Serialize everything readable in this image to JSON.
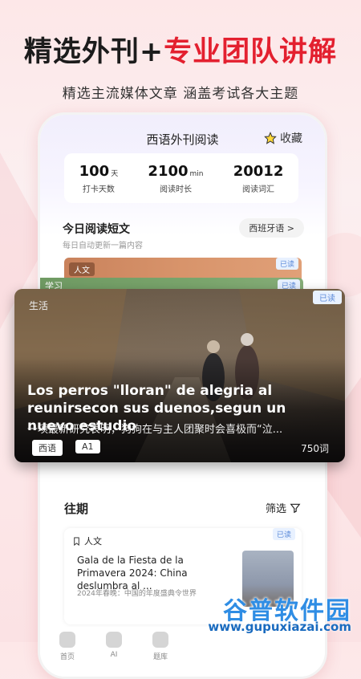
{
  "headline": {
    "part1": "精选外刊+",
    "part2": "专业团队讲解"
  },
  "subline": "精选主流媒体文章  涵盖考试各大主题",
  "app": {
    "title": "西语外刊阅读",
    "favorite_label": "收藏",
    "stats": [
      {
        "value": "100",
        "unit": "天",
        "label": "打卡天数"
      },
      {
        "value": "2100",
        "unit": "min",
        "label": "阅读时长"
      },
      {
        "value": "20012",
        "unit": "",
        "label": "阅读词汇"
      }
    ],
    "today": {
      "title": "今日阅读短文",
      "subtitle": "每日自动更新一篇内容",
      "language_button": "西班牙语 >"
    },
    "stack_card": {
      "category": "人文",
      "status": "已读"
    },
    "stack_card2": {
      "category": "学习",
      "status": "已读"
    },
    "featured": {
      "category": "生活",
      "status": "已读",
      "title": "Los perros \"lloran\" de alegria al reunirsecon sus duenos,segun un nuevo estudio",
      "summary": "一项最新研究表明，狗狗在与主人团聚时会喜极而“泣...",
      "tags": [
        "西语",
        "A1"
      ],
      "word_count": "750词"
    },
    "past": {
      "title": "往期",
      "filter_label": "筛选",
      "card": {
        "category": "人文",
        "status": "已读",
        "headline": "Gala de la Fiesta de la Primavera 2024: China deslumbra al ...",
        "meta": "2024年春晚：中国的年度盛典令世界"
      }
    },
    "nav": [
      {
        "label": "首页"
      },
      {
        "label": "AI"
      },
      {
        "label": "题库"
      }
    ]
  },
  "watermark": {
    "title": "谷普软件园",
    "url": "www.gupuxiazai.com"
  }
}
